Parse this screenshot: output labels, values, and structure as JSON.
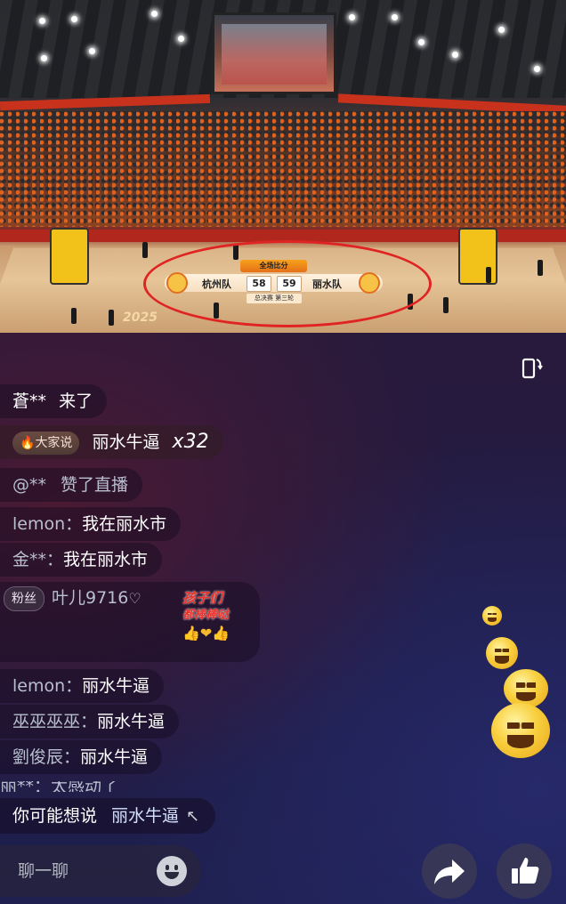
{
  "scoreboard": {
    "title": "全场比分",
    "home_team": "杭州队",
    "home_score": "58",
    "away_score": "59",
    "away_team": "丽水队",
    "subtitle": "总决赛 第三轮"
  },
  "court_text": "2025",
  "chat": {
    "messages": [
      {
        "type": "join",
        "user": "蒼**",
        "text": "来了"
      },
      {
        "type": "trend",
        "badge": "大家说",
        "text": "丽水牛逼",
        "count": "x32"
      },
      {
        "type": "like",
        "user": "@**",
        "text": "赞了直播"
      },
      {
        "type": "comment",
        "user": "lemon",
        "sep": "：",
        "text": "我在丽水市"
      },
      {
        "type": "comment",
        "user": "金**",
        "sep": "：",
        "text": "我在丽水市"
      },
      {
        "type": "sticker",
        "badge": "粉丝",
        "user": "叶儿9716",
        "sticker_line1": "孩子们",
        "sticker_line2": "都棒棒哒"
      },
      {
        "type": "comment",
        "user": "lemon",
        "sep": "：",
        "text": "丽水牛逼"
      },
      {
        "type": "comment",
        "user": "巫巫巫巫",
        "sep": "：",
        "text": "丽水牛逼"
      },
      {
        "type": "comment",
        "user": "劉俊辰",
        "sep": "：",
        "text": "丽水牛逼"
      }
    ],
    "faded_line": "丽**：太感动了"
  },
  "suggestion": {
    "label": "你可能想说",
    "value": "丽水牛逼",
    "arrow": "↖"
  },
  "input": {
    "placeholder": "聊一聊"
  },
  "icons": {
    "rotate": "rotate-screen-icon",
    "emoji": "smiley-icon",
    "share": "share-icon",
    "like": "thumbs-up-icon"
  },
  "colors": {
    "accent_red": "#e02424",
    "scoreboard_orange": "#e5701a"
  }
}
